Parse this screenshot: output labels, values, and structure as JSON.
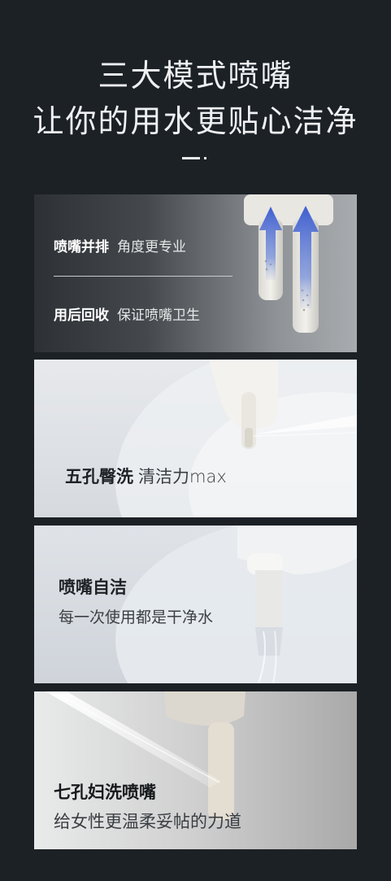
{
  "heading": {
    "line1": "三大模式喷嘴",
    "line2": "让你的用水更贴心洁净"
  },
  "panels": [
    {
      "rows": [
        {
          "keyword": "喷嘴并排",
          "desc": "角度更专业"
        },
        {
          "keyword": "用后回收",
          "desc": "保证喷嘴卫生"
        }
      ],
      "illustration": "twin-nozzle-arrows-icon"
    },
    {
      "keyword": "五孔臀洗",
      "desc": "清洁力max",
      "illustration": "rear-wash-spray-icon"
    },
    {
      "keyword": "喷嘴自洁",
      "desc": "每一次使用都是干净水",
      "illustration": "nozzle-self-clean-icon"
    },
    {
      "keyword": "七孔妇洗喷嘴",
      "desc": "给女性更温柔妥帖的力道",
      "illustration": "feminine-wash-spray-icon"
    }
  ],
  "colors": {
    "background": "#1c2126",
    "arrow_blue": "#4b6bd0",
    "text_light": "#eef0f2"
  }
}
